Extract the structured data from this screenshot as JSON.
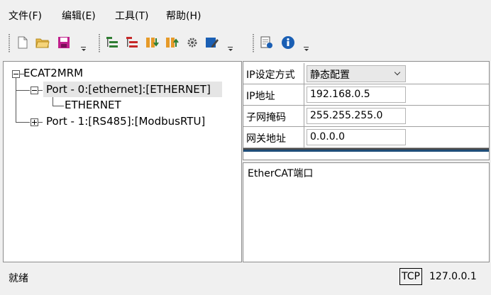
{
  "menu": {
    "file": "文件(F)",
    "edit": "编辑(E)",
    "tools": "工具(T)",
    "help": "帮助(H)"
  },
  "toolbar": {
    "icons": [
      "new-file-icon",
      "open-folder-icon",
      "save-icon",
      "tree-add-icon",
      "tree-remove-icon",
      "download-icon",
      "upload-icon",
      "settings-icon",
      "edit-icon",
      "monitor-icon",
      "info-icon"
    ]
  },
  "tree": {
    "root": "ECAT2MRM",
    "port0": "Port - 0:[ethernet]:[ETHERNET]",
    "port0_child": "ETHERNET",
    "port1": "Port - 1:[RS485]:[ModbusRTU]"
  },
  "props": {
    "ip_mode_label": "IP设定方式",
    "ip_mode_value": "静态配置",
    "ip_label": "IP地址",
    "ip_value": "192.168.0.5",
    "mask_label": "子网掩码",
    "mask_value": "255.255.255.0",
    "gateway_label": "网关地址",
    "gateway_value": "0.0.0.0"
  },
  "description": "EtherCAT端口",
  "status": {
    "text": "就绪",
    "protocol": "TCP",
    "address": "127.0.0.1"
  },
  "colors": {
    "selection": "#e5e5e5",
    "save_icon": "#c0208c",
    "info_icon": "#1a5fb4",
    "accent_bar": "#1f4e79"
  }
}
